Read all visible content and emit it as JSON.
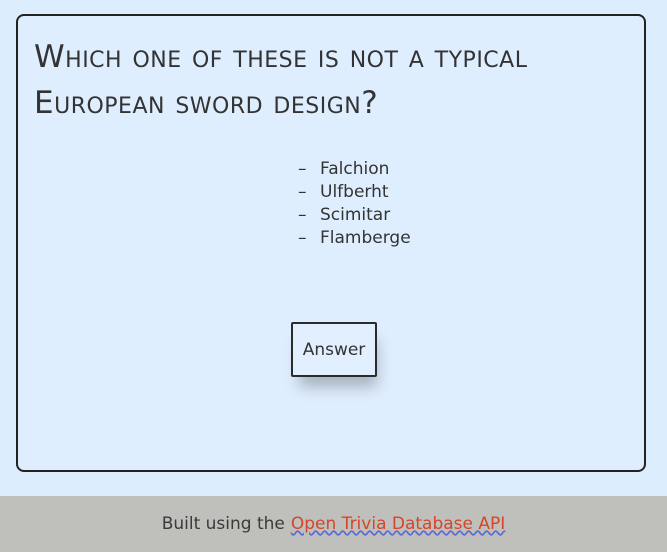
{
  "question": {
    "line1": "Which one of these is not a typical",
    "line2": "European sword design?"
  },
  "options": [
    {
      "dash": "–",
      "label": "Falchion"
    },
    {
      "dash": "–",
      "label": "Ulfberht"
    },
    {
      "dash": "–",
      "label": "Scimitar"
    },
    {
      "dash": "–",
      "label": "Flamberge"
    }
  ],
  "answer_button": {
    "label": "Answer"
  },
  "footer": {
    "text": "Built using the",
    "link_text": "Open Trivia Database API"
  }
}
